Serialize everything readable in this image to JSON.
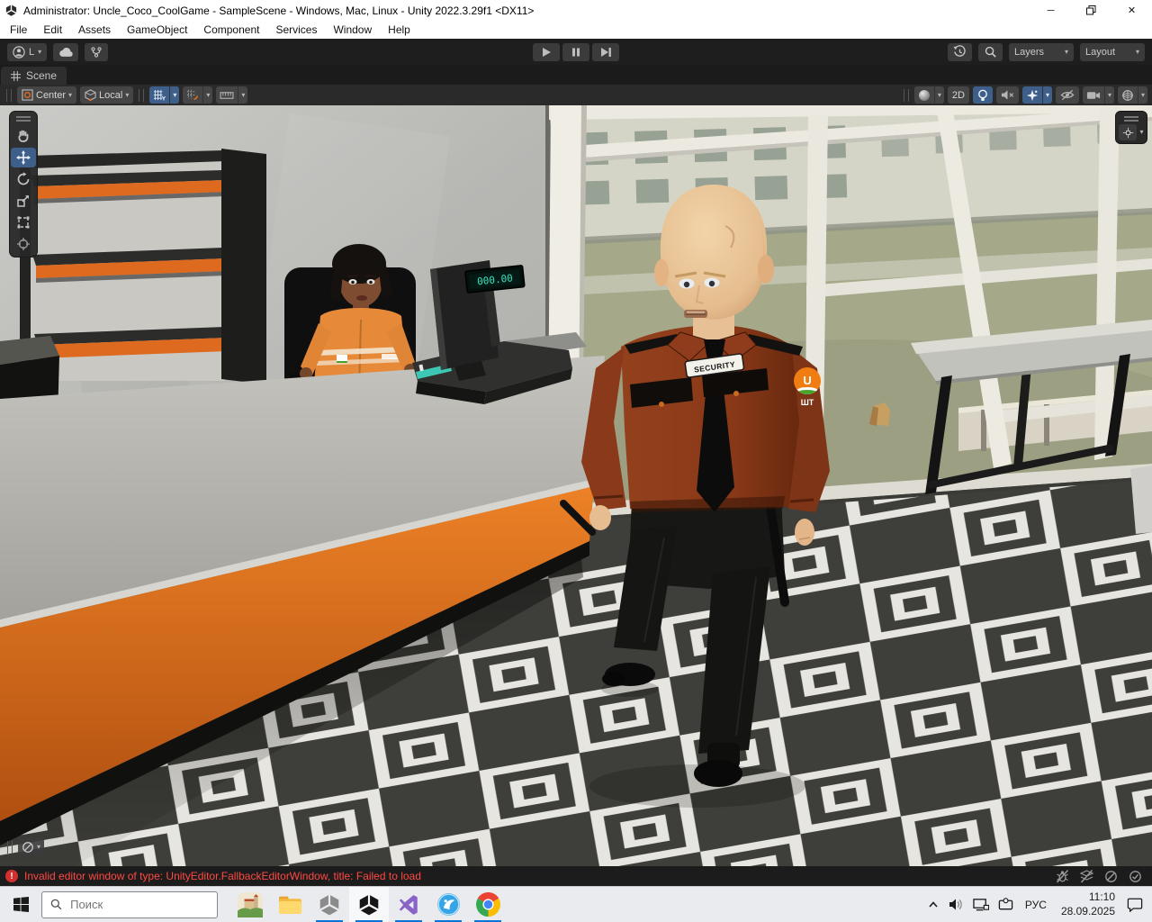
{
  "window": {
    "title": "Administrator: Uncle_Coco_CoolGame - SampleScene - Windows, Mac, Linux - Unity 2022.3.29f1 <DX11>"
  },
  "icons": {
    "dropdown": "▾",
    "minimize": "─",
    "close": "✕"
  },
  "menu": {
    "items": [
      "File",
      "Edit",
      "Assets",
      "GameObject",
      "Component",
      "Services",
      "Window",
      "Help"
    ]
  },
  "toolbar": {
    "account_label": "L",
    "layers_label": "Layers",
    "layout_label": "Layout"
  },
  "scene_tab": {
    "label": "Scene"
  },
  "scene_toolbar": {
    "pivot": "Center",
    "rotation": "Local",
    "mode_2d": "2D"
  },
  "scene": {
    "security_badge": "SECURITY",
    "register_display": "000.00",
    "uniform_patch": "ШТ"
  },
  "status_bar": {
    "error_text": "Invalid editor window of type: UnityEditor.FallbackEditorWindow, title: Failed to load"
  },
  "taskbar": {
    "search_placeholder": "Поиск",
    "language": "РУС",
    "time": "11:10",
    "date": "28.09.2025"
  }
}
